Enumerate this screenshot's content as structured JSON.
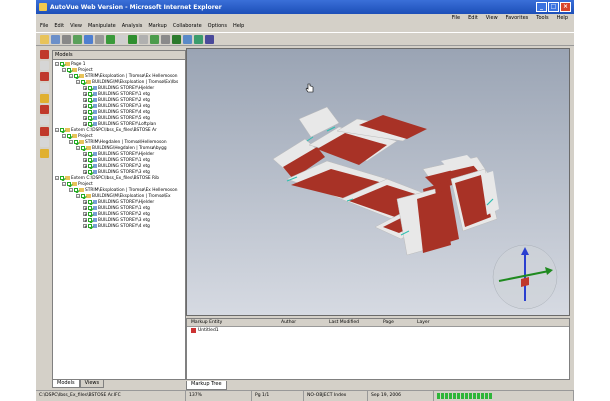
{
  "window": {
    "title": "AutoVue Web Version - Microsoft Internet Explorer"
  },
  "ie_menu": [
    "File",
    "Edit",
    "View",
    "Favorites",
    "Tools",
    "Help"
  ],
  "menubar": [
    "File",
    "Edit",
    "View",
    "Manipulate",
    "Analysis",
    "Markup",
    "Collaborate",
    "Options",
    "Help"
  ],
  "models_panel": {
    "title": "Models",
    "tree": [
      {
        "depth": 0,
        "expander": "-",
        "icon": "folder",
        "label": "Page 1"
      },
      {
        "depth": 1,
        "expander": "-",
        "icon": "folder",
        "label": "Project"
      },
      {
        "depth": 2,
        "expander": "-",
        "icon": "folder",
        "label": "STRIM\\Eksploation | Tromsø\\Ex Hellemoson"
      },
      {
        "depth": 3,
        "expander": "-",
        "icon": "folder",
        "label": "BUILDING\\M\\Eksploation | Tromsø\\Ex\\Ibs"
      },
      {
        "depth": 4,
        "expander": "+",
        "icon": "box",
        "label": "BUILDING STOREY\\Hjelder"
      },
      {
        "depth": 4,
        "expander": "+",
        "icon": "box",
        "label": "BUILDING STOREY\\1 etg"
      },
      {
        "depth": 4,
        "expander": "+",
        "icon": "box",
        "label": "BUILDING STOREY\\2 etg"
      },
      {
        "depth": 4,
        "expander": "+",
        "icon": "box",
        "label": "BUILDING STOREY\\3 etg"
      },
      {
        "depth": 4,
        "expander": "+",
        "icon": "box",
        "label": "BUILDING STOREY\\4 etg"
      },
      {
        "depth": 4,
        "expander": "+",
        "icon": "box",
        "label": "BUILDING STOREY\\5 etg"
      },
      {
        "depth": 4,
        "expander": "+",
        "icon": "box",
        "label": "BUILDING STOREY\\Loftplan"
      },
      {
        "depth": 0,
        "expander": "-",
        "icon": "folder",
        "label": "Extern C:\\DSPC\\Ibss_Ex_files\\BSTOSE Ar"
      },
      {
        "depth": 1,
        "expander": "-",
        "icon": "folder",
        "label": "Project"
      },
      {
        "depth": 2,
        "expander": "-",
        "icon": "folder",
        "label": "STRIM\\Hegdalen | Tromsø\\Hellemoson"
      },
      {
        "depth": 3,
        "expander": "-",
        "icon": "folder",
        "label": "BUILDING\\Hegdalen | Tromsø\\bygg"
      },
      {
        "depth": 4,
        "expander": "+",
        "icon": "box",
        "label": "BUILDING STOREY\\Hjelder"
      },
      {
        "depth": 4,
        "expander": "+",
        "icon": "box",
        "label": "BUILDING STOREY\\1 etg"
      },
      {
        "depth": 4,
        "expander": "+",
        "icon": "box",
        "label": "BUILDING STOREY\\2 etg"
      },
      {
        "depth": 4,
        "expander": "+",
        "icon": "box",
        "label": "BUILDING STOREY\\3 etg"
      },
      {
        "depth": 0,
        "expander": "-",
        "icon": "folder",
        "label": "Extern C:\\DSPC\\Ibss_Ex_files\\BSTOSE Rib"
      },
      {
        "depth": 1,
        "expander": "-",
        "icon": "folder",
        "label": "Project"
      },
      {
        "depth": 2,
        "expander": "-",
        "icon": "folder",
        "label": "STRIM\\Eksploation | Tromsø\\Ex Hellemoson"
      },
      {
        "depth": 3,
        "expander": "-",
        "icon": "folder",
        "label": "BUILDING\\M\\Eksploation | Tromsø\\Ex"
      },
      {
        "depth": 4,
        "expander": "+",
        "icon": "box",
        "label": "BUILDING STOREY\\Hjelder"
      },
      {
        "depth": 4,
        "expander": "+",
        "icon": "box",
        "label": "BUILDING STOREY\\1 etg"
      },
      {
        "depth": 4,
        "expander": "+",
        "icon": "box",
        "label": "BUILDING STOREY\\2 etg"
      },
      {
        "depth": 4,
        "expander": "+",
        "icon": "box",
        "label": "BUILDING STOREY\\3 etg"
      },
      {
        "depth": 4,
        "expander": "+",
        "icon": "box",
        "label": "BUILDING STOREY\\4 etg"
      }
    ],
    "tabs": [
      "Models",
      "Views"
    ]
  },
  "markup_panel": {
    "columns": [
      "Markup Entity",
      "Author",
      "Last Modified",
      "Page",
      "Layer"
    ],
    "rows": [
      {
        "entity": "Untitled1"
      }
    ],
    "tab": "Markup Tree"
  },
  "statusbar": {
    "path": "C:\\DSPC\\Ibss_Ex_files\\BSTOSE Ar.IFC",
    "zoom": "137%",
    "page": "Pg 1/1",
    "mode": "NO-OBJECT Index",
    "date": "Sep 19, 2006",
    "progress_cells": 14
  },
  "colors": {
    "title_bar": "#2456c4",
    "building_red": "#a83226",
    "building_white": "#e8e8e8",
    "progress": "#2fb53a"
  },
  "icons": [
    "open-icon",
    "print-icon",
    "zoom-icon",
    "rotate-icon",
    "select-icon",
    "markup-icon",
    "measure-icon",
    "navigation-cube-icon"
  ]
}
